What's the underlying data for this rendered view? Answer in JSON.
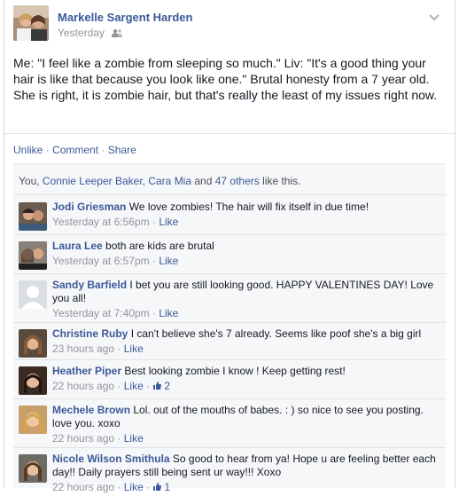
{
  "post": {
    "author": "Markelle Sargent Harden",
    "timestamp": "Yesterday",
    "privacy_icon": "friends-icon",
    "text": "Me: \"I feel like a zombie from sleeping so much.\" Liv: \"It's a good thing your hair is like that because you look like one.\" Brutal honesty from a 7 year old. She is right, it is zombie hair, but that's really the least of my issues right now.",
    "actions": {
      "unlike": "Unlike",
      "comment": "Comment",
      "share": "Share",
      "sep": "·"
    }
  },
  "likes": {
    "prefix": "You, ",
    "name1": "Connie Leeper Baker",
    "comma": ", ",
    "name2": "Cara Mia",
    "and": " and ",
    "others": "47 others",
    "suffix": " like this."
  },
  "comments": [
    {
      "name": "Jodi Griesman",
      "text": "We love zombies! The hair will fix itself in due time!",
      "time": "Yesterday at 6:56pm",
      "like": "Like",
      "count": ""
    },
    {
      "name": "Laura Lee",
      "text": "both are kids are brutal",
      "time": "Yesterday at 6:57pm",
      "like": "Like",
      "count": ""
    },
    {
      "name": "Sandy Barfield",
      "text": "I bet you are still looking good. HAPPY VALENTINES DAY! Love you all!",
      "time": "Yesterday at 7:40pm",
      "like": "Like",
      "count": ""
    },
    {
      "name": "Christine Ruby",
      "text": "I can't believe she's 7 already. Seems like poof she's a big girl",
      "time": "23 hours ago",
      "like": "Like",
      "count": ""
    },
    {
      "name": "Heather Piper",
      "text": "Best looking zombie I know ! Keep getting rest!",
      "time": "22 hours ago",
      "like": "Like",
      "count": "2"
    },
    {
      "name": "Mechele Brown",
      "text": "Lol. out of the mouths of babes. : ) so nice to see you posting. love you. xoxo",
      "time": "22 hours ago",
      "like": "Like",
      "count": ""
    },
    {
      "name": "Nicole Wilson Smithula",
      "text": "So good to hear from ya! Hope u are feeling better each day!! Daily prayers still being sent ur way!!! Xoxo",
      "time": "22 hours ago",
      "like": "Like",
      "count": "1"
    }
  ]
}
